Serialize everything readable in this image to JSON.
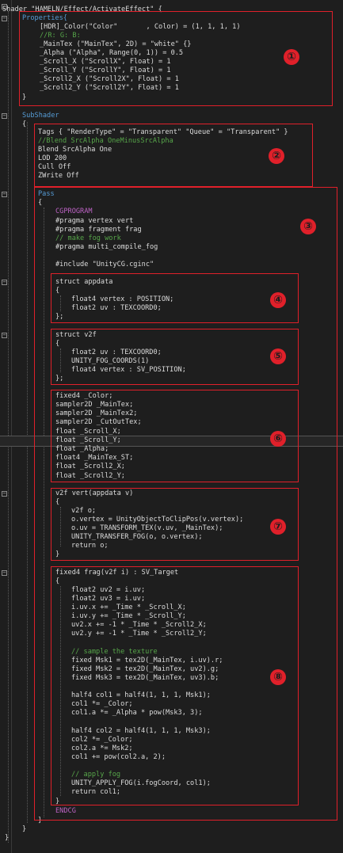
{
  "editor": {
    "lines": [
      {
        "text": "Shader \"HAMELN/Effect/ActivateEffect\" {",
        "cls": ""
      },
      {
        "text": "Properties{",
        "cls": "kw"
      },
      {
        "text": "[HDR]_Color(\"Color\"       , Color) = (1, 1, 1, 1)",
        "cls": ""
      },
      {
        "text": "//R: G: B:",
        "cls": "cm"
      },
      {
        "text": "_MainTex (\"MainTex\", 2D) = \"white\" {}",
        "cls": ""
      },
      {
        "text": "_Alpha (\"Alpha\", Range(0, 1)) = 0.5",
        "cls": ""
      },
      {
        "text": "_Scroll_X (\"ScrollX\", Float) = 1",
        "cls": ""
      },
      {
        "text": "_Scroll_Y (\"ScrollY\", Float) = 1",
        "cls": ""
      },
      {
        "text": "_Scroll2_X (\"Scroll2X\", Float) = 1",
        "cls": ""
      },
      {
        "text": "_Scroll2_Y (\"Scroll2Y\", Float) = 1",
        "cls": ""
      },
      {
        "text": "}",
        "cls": ""
      },
      {
        "text": "SubShader",
        "cls": "kw"
      },
      {
        "text": "{",
        "cls": ""
      },
      {
        "text": "Tags { \"RenderType\" = \"Transparent\" \"Queue\" = \"Transparent\" }",
        "cls": ""
      },
      {
        "text": "//Blend SrcAlpha OneMinusSrcAlpha",
        "cls": "cm"
      },
      {
        "text": "Blend SrcAlpha One",
        "cls": ""
      },
      {
        "text": "LOD 200",
        "cls": ""
      },
      {
        "text": "Cull Off",
        "cls": ""
      },
      {
        "text": "ZWrite Off",
        "cls": ""
      },
      {
        "text": "Pass",
        "cls": "kw"
      },
      {
        "text": "{",
        "cls": ""
      },
      {
        "text": "CGPROGRAM",
        "cls": "mac"
      },
      {
        "text": "#pragma vertex vert",
        "cls": ""
      },
      {
        "text": "#pragma fragment frag",
        "cls": ""
      },
      {
        "text": "// make fog work",
        "cls": "cm"
      },
      {
        "text": "#pragma multi_compile_fog",
        "cls": ""
      },
      {
        "text": "#include \"UnityCG.cginc\"",
        "cls": ""
      },
      {
        "text": "struct appdata",
        "cls": ""
      },
      {
        "text": "{",
        "cls": ""
      },
      {
        "text": "float4 vertex : POSITION;",
        "cls": ""
      },
      {
        "text": "float2 uv : TEXCOORD0;",
        "cls": ""
      },
      {
        "text": "};",
        "cls": ""
      },
      {
        "text": "struct v2f",
        "cls": ""
      },
      {
        "text": "{",
        "cls": ""
      },
      {
        "text": "float2 uv : TEXCOORD0;",
        "cls": ""
      },
      {
        "text": "UNITY_FOG_COORDS(1)",
        "cls": ""
      },
      {
        "text": "float4 vertex : SV_POSITION;",
        "cls": ""
      },
      {
        "text": "};",
        "cls": ""
      },
      {
        "text": "fixed4 _Color;",
        "cls": ""
      },
      {
        "text": "sampler2D _MainTex;",
        "cls": ""
      },
      {
        "text": "sampler2D _MainTex2;",
        "cls": ""
      },
      {
        "text": "sampler2D _CutOutTex;",
        "cls": ""
      },
      {
        "text": "float _Scroll_X;",
        "cls": ""
      },
      {
        "text": "float _Scroll_Y;",
        "cls": ""
      },
      {
        "text": "float _Alpha;",
        "cls": ""
      },
      {
        "text": "float4 _MainTex_ST;",
        "cls": ""
      },
      {
        "text": "float _Scroll2_X;",
        "cls": ""
      },
      {
        "text": "float _Scroll2_Y;",
        "cls": ""
      },
      {
        "text": "v2f vert(appdata v)",
        "cls": ""
      },
      {
        "text": "{",
        "cls": ""
      },
      {
        "text": "v2f o;",
        "cls": ""
      },
      {
        "text": "o.vertex = UnityObjectToClipPos(v.vertex);",
        "cls": ""
      },
      {
        "text": "o.uv = TRANSFORM_TEX(v.uv, _MainTex);",
        "cls": ""
      },
      {
        "text": "UNITY_TRANSFER_FOG(o, o.vertex);",
        "cls": ""
      },
      {
        "text": "return o;",
        "cls": ""
      },
      {
        "text": "}",
        "cls": ""
      },
      {
        "text": "fixed4 frag(v2f i) : SV_Target",
        "cls": ""
      },
      {
        "text": "{",
        "cls": ""
      },
      {
        "text": "float2 uv2 = i.uv;",
        "cls": ""
      },
      {
        "text": "float2 uv3 = i.uv;",
        "cls": ""
      },
      {
        "text": "i.uv.x += _Time * _Scroll_X;",
        "cls": ""
      },
      {
        "text": "i.uv.y += _Time * _Scroll_Y;",
        "cls": ""
      },
      {
        "text": "uv2.x += -1 * _Time * _Scroll2_X;",
        "cls": ""
      },
      {
        "text": "uv2.y += -1 * _Time * _Scroll2_Y;",
        "cls": ""
      },
      {
        "text": "// sample the texture",
        "cls": "cm"
      },
      {
        "text": "fixed Msk1 = tex2D(_MainTex, i.uv).r;",
        "cls": ""
      },
      {
        "text": "fixed Msk2 = tex2D(_MainTex, uv2).g;",
        "cls": ""
      },
      {
        "text": "fixed Msk3 = tex2D(_MainTex, uv3).b;",
        "cls": ""
      },
      {
        "text": "half4 col1 = half4(1, 1, 1, Msk1);",
        "cls": ""
      },
      {
        "text": "col1 *= _Color;",
        "cls": ""
      },
      {
        "text": "col1.a *= _Alpha * pow(Msk3, 3);",
        "cls": ""
      },
      {
        "text": "half4 col2 = half4(1, 1, 1, Msk3);",
        "cls": ""
      },
      {
        "text": "col2 *= _Color;",
        "cls": ""
      },
      {
        "text": "col2.a *= Msk2;",
        "cls": ""
      },
      {
        "text": "col1 += pow(col2.a, 2);",
        "cls": ""
      },
      {
        "text": "// apply fog",
        "cls": "cm"
      },
      {
        "text": "UNITY_APPLY_FOG(i.fogCoord, col1);",
        "cls": ""
      },
      {
        "text": "return col1;",
        "cls": ""
      },
      {
        "text": "}",
        "cls": ""
      },
      {
        "text": "ENDCG",
        "cls": "mac"
      },
      {
        "text": "}",
        "cls": ""
      },
      {
        "text": "}",
        "cls": ""
      },
      {
        "text": "}",
        "cls": ""
      }
    ]
  },
  "annotations": {
    "color": "#e0202a",
    "markers": [
      "①",
      "②",
      "③",
      "④",
      "⑤",
      "⑥",
      "⑦",
      "⑧"
    ]
  }
}
